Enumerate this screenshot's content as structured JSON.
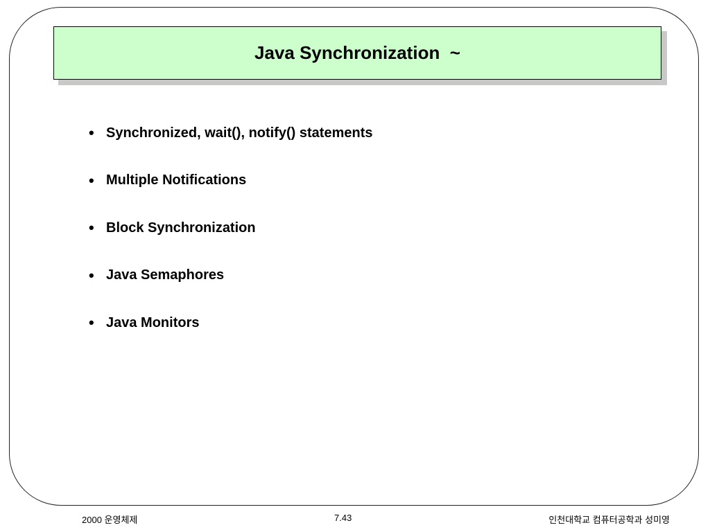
{
  "slide": {
    "title": "Java Synchronization  ~",
    "bullets": [
      {
        "text": "Synchronized, wait(), notify() statements"
      },
      {
        "text": "Multiple Notifications"
      },
      {
        "text": "Block Synchronization"
      },
      {
        "text": "Java Semaphores"
      },
      {
        "text": "Java Monitors"
      }
    ],
    "bullet_symbol": "•"
  },
  "footer": {
    "left": "2000 운영체제",
    "center": "7.43",
    "right": "인천대학교 컴퓨터공학과 성미영"
  },
  "colors": {
    "title_background": "#ccffcc",
    "title_shadow": "#c8c8c8"
  }
}
